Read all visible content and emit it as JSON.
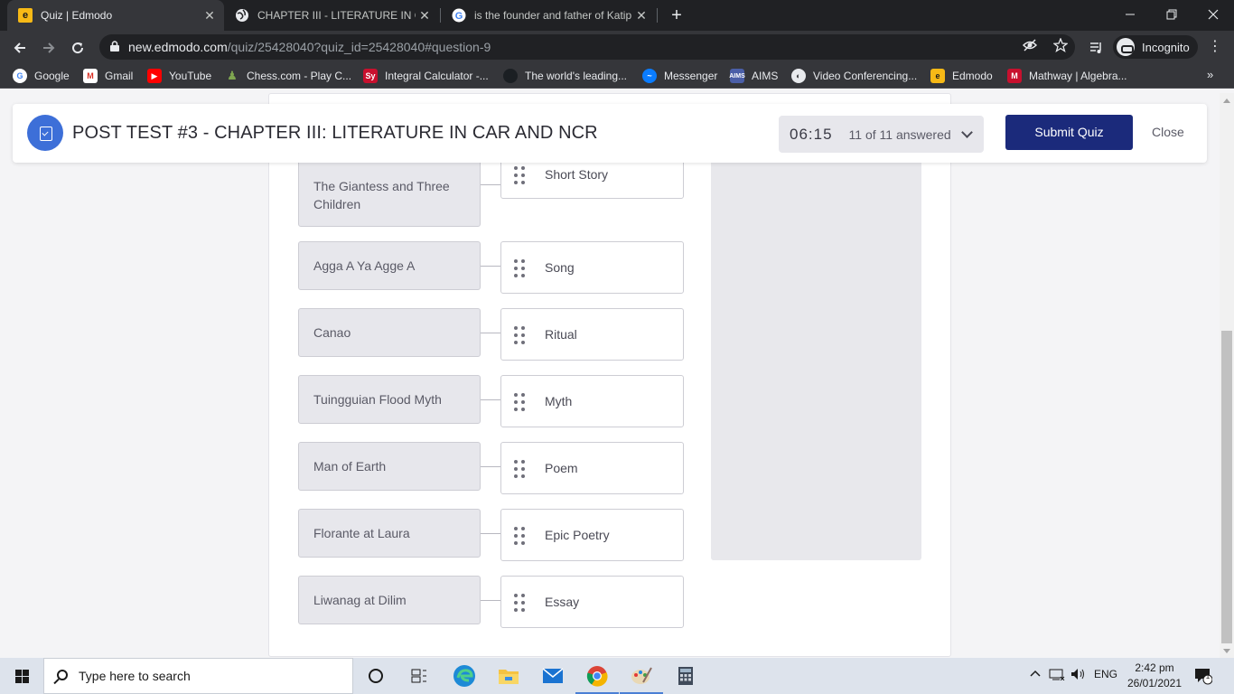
{
  "browser": {
    "tabs": [
      {
        "title": "Quiz | Edmodo",
        "close": "✕"
      },
      {
        "title": "CHAPTER III - LITERATURE IN CAR",
        "close": "✕"
      },
      {
        "title": "is the founder and father of Katip",
        "close": "✕"
      }
    ],
    "new_tab": "+",
    "url_host": "new.edmodo.com",
    "url_path": "/quiz/25428040?quiz_id=25428040#question-9",
    "incognito_label": "Incognito",
    "bookmarks": [
      {
        "label": "Google",
        "color": "#ffffff"
      },
      {
        "label": "Gmail",
        "color": "#d93025"
      },
      {
        "label": "YouTube",
        "color": "#ff0000"
      },
      {
        "label": "Chess.com - Play C...",
        "color": "#7fa650"
      },
      {
        "label": "Integral Calculator -...",
        "color": "#c8102e"
      },
      {
        "label": "The world's leading...",
        "color": "#1b1f23"
      },
      {
        "label": "Messenger",
        "color": "#0a7cff"
      },
      {
        "label": "AIMS",
        "color": "#4b5fa8"
      },
      {
        "label": "Video Conferencing...",
        "color": "#e8eaed"
      },
      {
        "label": "Edmodo",
        "color": "#f7b916"
      },
      {
        "label": "Mathway | Algebra...",
        "color": "#c8102e"
      }
    ],
    "bookmarks_more": "»"
  },
  "quiz": {
    "title": "POST TEST #3 - CHAPTER III: LITERATURE IN CAR AND NCR",
    "timer": "06:15",
    "answered": "11 of 11 answered",
    "submit_label": "Submit Quiz",
    "close_label": "Close",
    "brand_color": "#1b2a7b",
    "icon_color": "#3d6fd8"
  },
  "matching": {
    "left": [
      "The Giantess and Three Children",
      "Agga A Ya Agge A",
      "Canao",
      "Tuingguian Flood Myth",
      "Man of Earth",
      "Florante at Laura",
      "Liwanag at Dilim"
    ],
    "right": [
      "Short Story",
      "Song",
      "Ritual",
      "Myth",
      "Poem",
      "Epic Poetry",
      "Essay"
    ]
  },
  "taskbar": {
    "search_placeholder": "Type here to search",
    "language": "ENG",
    "time": "2:42 pm",
    "date": "26/01/2021",
    "notification_count": "1"
  }
}
